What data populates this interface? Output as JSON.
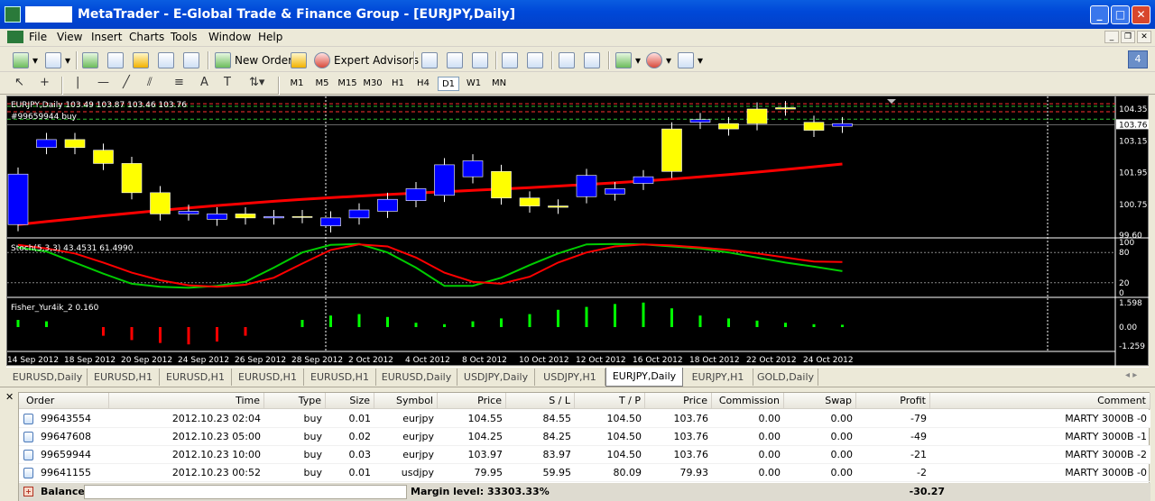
{
  "window": {
    "title": "MetaTrader - E-Global Trade & Finance Group - [EURJPY,Daily]"
  },
  "menu": [
    "File",
    "View",
    "Insert",
    "Charts",
    "Tools",
    "Window",
    "Help"
  ],
  "toolbar": {
    "new_order": "New Order",
    "expert_advisors": "Expert Advisors",
    "notify_count": "4"
  },
  "timeframes": [
    "M1",
    "M5",
    "M15",
    "M30",
    "H1",
    "H4",
    "D1",
    "W1",
    "MN"
  ],
  "active_timeframe": "D1",
  "chart": {
    "header": "EURJPY,Daily  103.49 103.87 103.46 103.76",
    "order_label": "#99659944 buy",
    "price_ticks": [
      "104.35",
      "103.76",
      "103.15",
      "101.95",
      "100.75",
      "99.60"
    ],
    "current_price": "103.76",
    "stoch_label": "Stoch(5,3,3) 43.4531 61.4990",
    "stoch_ticks": [
      "100",
      "80",
      "20",
      "0"
    ],
    "fisher_label": "Fisher_Yur4ik_2 0.160",
    "fisher_ticks": [
      "1.598",
      "0.00",
      "-1.259"
    ],
    "date_ticks": [
      "14 Sep 2012",
      "18 Sep 2012",
      "20 Sep 2012",
      "24 Sep 2012",
      "26 Sep 2012",
      "28 Sep 2012",
      "2 Oct 2012",
      "4 Oct 2012",
      "8 Oct 2012",
      "10 Oct 2012",
      "12 Oct 2012",
      "16 Oct 2012",
      "18 Oct 2012",
      "22 Oct 2012",
      "24 Oct 2012"
    ],
    "colors": {
      "bull": "#ffff00",
      "bear": "#0000ff",
      "ma": "#ff0000",
      "stoch_main": "#00cc00",
      "stoch_signal": "#ff0000"
    }
  },
  "chart_data": {
    "type": "candlestick",
    "x": [
      "13 Sep",
      "14 Sep",
      "17 Sep",
      "18 Sep",
      "19 Sep",
      "20 Sep",
      "21 Sep",
      "24 Sep",
      "25 Sep",
      "26 Sep",
      "27 Sep",
      "28 Sep",
      "1 Oct",
      "2 Oct",
      "3 Oct",
      "4 Oct",
      "5 Oct",
      "8 Oct",
      "9 Oct",
      "10 Oct",
      "11 Oct",
      "12 Oct",
      "15 Oct",
      "16 Oct",
      "17 Oct",
      "18 Oct",
      "19 Oct",
      "22 Oct",
      "23 Oct",
      "24 Oct"
    ],
    "open": [
      100.0,
      102.9,
      103.2,
      102.8,
      102.3,
      101.2,
      100.4,
      100.2,
      100.4,
      100.25,
      100.3,
      99.95,
      100.25,
      100.5,
      100.9,
      101.1,
      101.8,
      102.0,
      101.0,
      100.7,
      101.05,
      101.15,
      101.55,
      103.6,
      103.85,
      103.8,
      104.35,
      104.4,
      103.85,
      103.7
    ],
    "close": [
      101.9,
      103.2,
      102.9,
      102.3,
      101.2,
      100.4,
      100.5,
      100.4,
      100.25,
      100.3,
      100.3,
      100.25,
      100.55,
      100.95,
      101.35,
      102.25,
      102.4,
      101.0,
      100.7,
      100.65,
      101.85,
      101.35,
      101.8,
      102.0,
      103.95,
      103.6,
      103.8,
      104.35,
      103.55,
      103.8
    ],
    "ylim": [
      99.6,
      104.35
    ],
    "stochastic": {
      "main": 43.4531,
      "signal": 61.499,
      "levels": [
        80,
        20
      ]
    },
    "fisher": {
      "value": 0.16,
      "range": [
        -1.259,
        1.598
      ]
    }
  },
  "symbol_tabs": [
    "EURUSD,Daily",
    "EURUSD,H1",
    "EURUSD,H1",
    "EURUSD,H1",
    "EURUSD,H1",
    "EURUSD,Daily",
    "USDJPY,Daily",
    "USDJPY,H1",
    "EURJPY,Daily",
    "EURJPY,H1",
    "GOLD,Daily"
  ],
  "active_tab": 8,
  "terminal": {
    "columns": [
      "Order",
      "Time",
      "Type",
      "Size",
      "Symbol",
      "Price",
      "S / L",
      "T / P",
      "Price",
      "Commission",
      "Swap",
      "Profit",
      "Comment"
    ],
    "rows": [
      [
        "99643554",
        "2012.10.23 02:04",
        "buy",
        "0.01",
        "eurjpy",
        "104.55",
        "84.55",
        "104.50",
        "103.76",
        "0.00",
        "0.00",
        "-79",
        "MARTY 3000B -0"
      ],
      [
        "99647608",
        "2012.10.23 05:00",
        "buy",
        "0.02",
        "eurjpy",
        "104.25",
        "84.25",
        "104.50",
        "103.76",
        "0.00",
        "0.00",
        "-49",
        "MARTY 3000B -1"
      ],
      [
        "99659944",
        "2012.10.23 10:00",
        "buy",
        "0.03",
        "eurjpy",
        "103.97",
        "83.97",
        "104.50",
        "103.76",
        "0.00",
        "0.00",
        "-21",
        "MARTY 3000B -2"
      ],
      [
        "99641155",
        "2012.10.23 00:52",
        "buy",
        "0.01",
        "usdjpy",
        "79.95",
        "59.95",
        "80.09",
        "79.93",
        "0.00",
        "0.00",
        "-2",
        "MARTY 3000B -0"
      ]
    ],
    "balance_label": "Balance:",
    "margin_level": "Margin level: 33303.33%",
    "total_profit": "-30.27"
  }
}
